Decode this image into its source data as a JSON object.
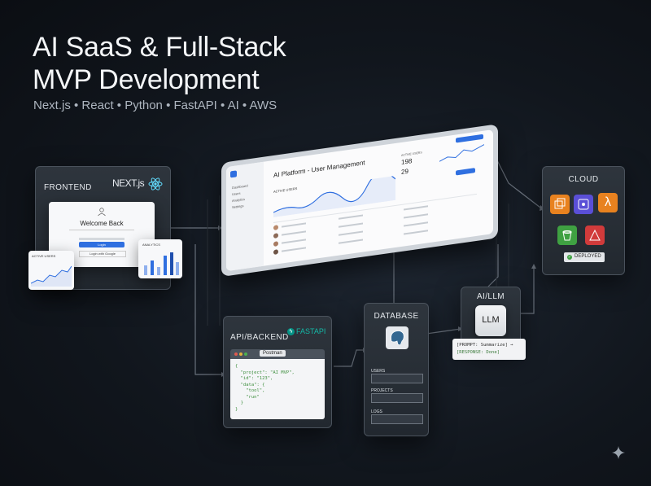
{
  "hero": {
    "title_line1": "AI SaaS & Full-Stack",
    "title_line2": "MVP Development",
    "subtitle": "Next.js • React • Python • FastAPI • AI • AWS"
  },
  "frontend": {
    "label": "FRONTEND",
    "brand": "NEXT.js",
    "login_title": "Welcome Back",
    "login_button": "Login",
    "google_button": "Login with Google",
    "active_users_label": "ACTIVE USERS",
    "analytics_label": "ANALYTICS"
  },
  "dashboard": {
    "title": "AI Platform - User Management",
    "nav": [
      "Dashboard",
      "Users",
      "Analytics",
      "Settings"
    ],
    "active_users_label": "ACTIVE USERS",
    "stats": [
      {
        "label": "ACTIVE USERS",
        "value": "198"
      },
      {
        "label": "",
        "value": "29"
      }
    ],
    "table_rows": 4
  },
  "cloud": {
    "label": "CLOUD",
    "status": "DEPLOYED"
  },
  "backend": {
    "label": "API/BACKEND",
    "brand": "FASTAPI",
    "tool": "Postman",
    "json_lines": [
      "{",
      "  \"project\": \"AI MVP\",",
      "  \"id\": \"123\",",
      "  \"data\": {",
      "    \"tool\",",
      "    \"run\"",
      "  }",
      "}"
    ]
  },
  "database": {
    "label": "DATABASE",
    "tables": [
      "USERS",
      "PROJECTS",
      "LOGS"
    ]
  },
  "ai": {
    "label": "AI/LLM",
    "chip": "LLM",
    "prompt_line": "[PROMPT: Summarize] →",
    "response_line": "[RESPONSE: Done]"
  },
  "colors": {
    "accent_blue": "#2f6fe0",
    "aws_orange": "#e8821f",
    "aws_green": "#3fa142",
    "aws_red": "#d13b3b",
    "json_green": "#3f8f3f"
  }
}
